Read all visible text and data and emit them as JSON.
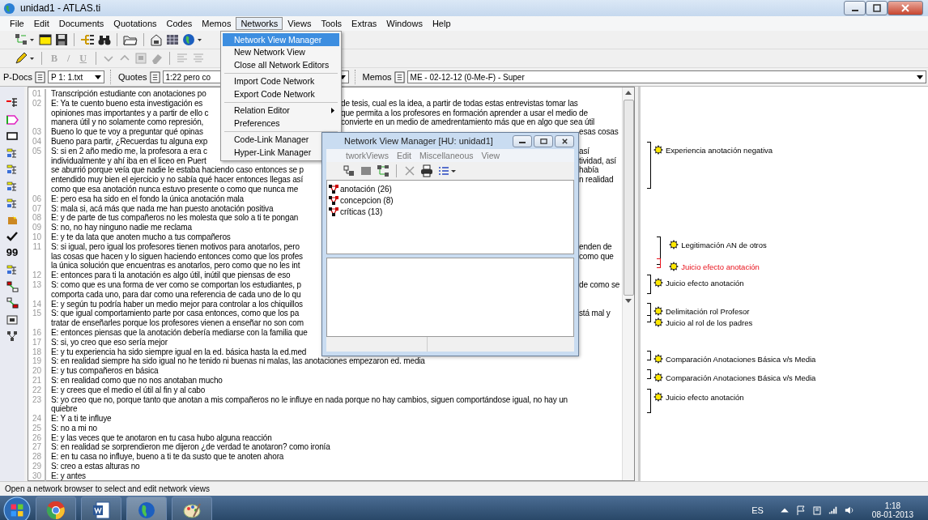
{
  "window": {
    "title": "unidad1 - ATLAS.ti"
  },
  "menu_bar": [
    {
      "label": "File",
      "selected": false
    },
    {
      "label": "Edit",
      "selected": false
    },
    {
      "label": "Documents",
      "selected": false
    },
    {
      "label": "Quotations",
      "selected": false
    },
    {
      "label": "Codes",
      "selected": false
    },
    {
      "label": "Memos",
      "selected": false
    },
    {
      "label": "Networks",
      "selected": true
    },
    {
      "label": "Views",
      "selected": false
    },
    {
      "label": "Tools",
      "selected": false
    },
    {
      "label": "Extras",
      "selected": false
    },
    {
      "label": "Windows",
      "selected": false
    },
    {
      "label": "Help",
      "selected": false
    }
  ],
  "networks_menu": [
    [
      {
        "label": "Network View  Manager",
        "selected": true,
        "submenu": false
      },
      {
        "label": "New Network View",
        "selected": false,
        "submenu": false
      },
      {
        "label": "Close all Network Editors",
        "selected": false,
        "submenu": false
      }
    ],
    [
      {
        "label": "Import Code Network",
        "selected": false,
        "submenu": false
      },
      {
        "label": "Export Code Network",
        "selected": false,
        "submenu": false
      }
    ],
    [
      {
        "label": "Relation Editor",
        "selected": false,
        "submenu": true
      },
      {
        "label": "Preferences",
        "selected": false,
        "submenu": false
      }
    ],
    [
      {
        "label": "Code-Link  Manager",
        "selected": false,
        "submenu": false
      },
      {
        "label": "Hyper-Link  Manager",
        "selected": false,
        "submenu": false
      }
    ]
  ],
  "format_buttons": [
    {
      "label": "B",
      "disabled": true
    },
    {
      "label": "/",
      "disabled": true
    },
    {
      "label": "U",
      "disabled": true
    }
  ],
  "selectors": {
    "pdocs_label": "P-Docs",
    "pdocs_value": "P 1: 1.txt",
    "quotes_label": "Quotes",
    "quotes_value": "1:22 pero co",
    "memos_label": "Memos",
    "memos_value": "ME - 02-12-12 (0-Me-F) - Super"
  },
  "side_toolbar": {
    "quote_glyph": "99"
  },
  "document": {
    "rows": [
      {
        "num": "01",
        "text": "Transcripción estudiante con anotaciones po"
      },
      {
        "num": "02",
        "text": "E: Ya te cuento bueno esta investigación es",
        "tail": "de tesis, cual es la idea, a partir de todas estas entrevistas tomar las"
      },
      {
        "text": "opiniones mas importantes y a partir de ello c",
        "tail": "que permita a los profesores en formación aprender a usar el medio de"
      },
      {
        "text": "manera útil y no solamente como represión,",
        "tail": "convierte en un medio de amedrentamiento más que en algo que sea útil"
      },
      {
        "num": "03",
        "text": "Bueno lo que te voy a preguntar qué opinas",
        "tail": "esas cosas"
      },
      {
        "num": "04",
        "text": "Bueno para partir, ¿Recuerdas tu alguna  exp"
      },
      {
        "num": "05",
        "text": "S: si en 2 año medio me, la profesora a era c",
        "tail": "así"
      },
      {
        "text": "individualmente y ahí iba en el liceo en Puert",
        "tail": "tividad, así"
      },
      {
        "text": "se aburrió porque veía que nadie le estaba haciendo caso entonces se p",
        "tail": "había"
      },
      {
        "text": "entendido muy bien el ejercicio y no sabía qué hacer entonces llegas así",
        "tail": "n realidad"
      },
      {
        "text": "como que esa anotación nunca estuvo presente o como que nunca me"
      },
      {
        "num": "06",
        "text": "E: pero esa ha sido en el fondo la única anotación mala"
      },
      {
        "num": "07",
        "text": "S: mala si, acá más que nada me han puesto anotación positiva"
      },
      {
        "num": "08",
        "text": "E: y de parte de tus compañeros no les molesta que solo a ti te pongan"
      },
      {
        "num": "09",
        "text": "S: no, no hay ninguno nadie me reclama"
      },
      {
        "num": "10",
        "text": "E: y te da lata que anoten mucho a tus compañeros"
      },
      {
        "num": "11",
        "text": "S: si igual, pero igual los profesores tienen motivos para anotarlos, pero",
        "tail": "enden de"
      },
      {
        "text": "las cosas que hacen y lo siguen haciendo entonces como que los profes",
        "tail": "como que"
      },
      {
        "text": "la única solución que encuentras es anotarlos, pero como que no les int"
      },
      {
        "num": "12",
        "text": "E: entonces para ti la anotación es algo útil, inútil que piensas de eso"
      },
      {
        "num": "13",
        "text": "S: como que es una forma de ver como se comportan los estudiantes, p",
        "tail": "de como se"
      },
      {
        "text": "comporta cada uno, para dar como una referencia de cada uno de lo qu"
      },
      {
        "num": "14",
        "text": "E: y según tu podría haber un medio mejor para controlar a los chiquillos"
      },
      {
        "num": "15",
        "text": "S: que igual comportamiento parte por casa entonces, como que los pa",
        "tail": "stá mal y"
      },
      {
        "text": "tratar de enseñarles porque los profesores vienen a enseñar no son com"
      },
      {
        "num": "16",
        "text": "E: entonces piensas que la anotación debería mediarse con la familia que"
      },
      {
        "num": "17",
        "text": "S: si, yo creo que eso sería mejor"
      },
      {
        "num": "18",
        "text": "E: y tu experiencia ha sido siempre igual en la ed. básica hasta la ed.med"
      },
      {
        "num": "19",
        "text": "S: en realidad siempre ha sido igual no he tenido ni buenas ni malas, las anotaciones empezaron ed. media"
      },
      {
        "num": "20",
        "text": "E: y tus compañeros en básica"
      },
      {
        "num": "21",
        "text": "S: en realidad como que no nos anotaban mucho"
      },
      {
        "num": "22",
        "text": "E: y crees que el medio el útil al fin y al cabo"
      },
      {
        "num": "23",
        "text": "S: yo creo que no, porque tanto que anotan a mis compañeros no le influye en nada porque no hay cambios, siguen comportándose igual, no hay un"
      },
      {
        "text": "quiebre"
      },
      {
        "num": "24",
        "text": "E: Y a ti te influye"
      },
      {
        "num": "25",
        "text": "S: no a mi no"
      },
      {
        "num": "26",
        "text": "E: y las veces que te anotaron en tu casa hubo alguna reacción"
      },
      {
        "num": "27",
        "text": "S: en realidad se sorprendieron me dijeron ¿de verdad te anotaron? como ironía"
      },
      {
        "num": "28",
        "text": "E: en tu casa no influye, bueno a ti te da susto que te anoten ahora"
      },
      {
        "num": "29",
        "text": "S: creo a estas alturas no"
      },
      {
        "num": "30",
        "text": "E: y antes"
      }
    ]
  },
  "codes": [
    {
      "label": "Experiencia anotación negativa",
      "color": "#000000"
    },
    {
      "label": "Legitimación AN de otros",
      "color": "#000000"
    },
    {
      "label": "Juicio efecto anotación",
      "color": "#e8101a"
    },
    {
      "label": "Juicio efecto anotación",
      "color": "#000000"
    },
    {
      "label": "Delimitación rol Profesor",
      "color": "#000000"
    },
    {
      "label": "Juicio al rol de los padres",
      "color": "#000000"
    },
    {
      "label": "Comparación Anotaciones Básica v/s Media",
      "color": "#000000"
    },
    {
      "label": "Comparación Anotaciones Básica v/s Media",
      "color": "#000000"
    },
    {
      "label": "Juicio efecto anotación",
      "color": "#000000"
    }
  ],
  "dialog": {
    "title": "Network View Manager [HU: unidad1]",
    "menu": [
      "tworkViews",
      "Edit",
      "Miscellaneous",
      "View"
    ],
    "networks": [
      "anotación (26)",
      "concepcion (8)",
      "críticas (13)"
    ]
  },
  "status_bar": "Open a network browser to select and edit network views",
  "taskbar": {
    "language": "ES",
    "time": "1:18",
    "date": "08-01-2013"
  }
}
